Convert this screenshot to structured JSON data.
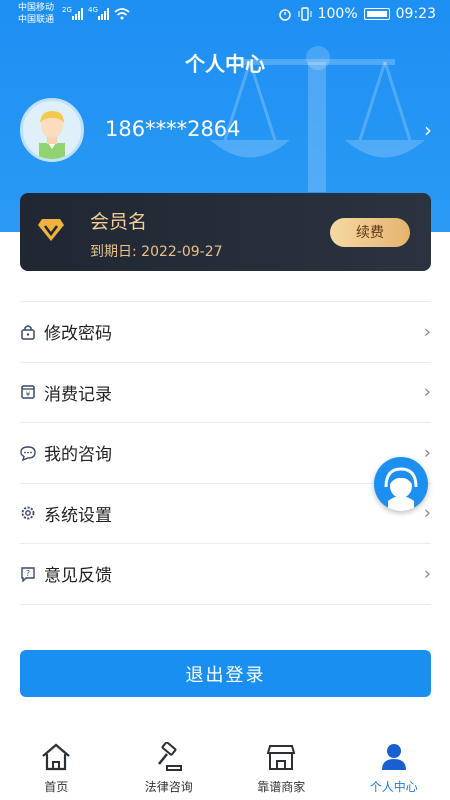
{
  "status_bar": {
    "carrier1": "中国移动",
    "carrier2": "中国联通",
    "net1": "2G",
    "net2": "4G",
    "battery": "100%",
    "time": "09:23"
  },
  "header": {
    "title": "个人中心"
  },
  "profile": {
    "phone": "186****2864"
  },
  "vip": {
    "name": "会员名",
    "expiry": "到期日: 2022-09-27",
    "renew_label": "续费"
  },
  "menu": [
    {
      "label": "修改密码",
      "icon": "lock-icon"
    },
    {
      "label": "消费记录",
      "icon": "receipt-icon"
    },
    {
      "label": "我的咨询",
      "icon": "chat-icon"
    },
    {
      "label": "系统设置",
      "icon": "gear-icon"
    },
    {
      "label": "意见反馈",
      "icon": "feedback-icon"
    }
  ],
  "logout_label": "退出登录",
  "tabs": [
    {
      "label": "首页",
      "icon": "home-icon"
    },
    {
      "label": "法律咨询",
      "icon": "gavel-icon"
    },
    {
      "label": "靠谱商家",
      "icon": "store-icon"
    },
    {
      "label": "个人中心",
      "icon": "user-icon",
      "active": true
    }
  ],
  "colors": {
    "primary": "#1a8ff2",
    "vip_gold": "#f4cf95",
    "card_dark": "#1f2733"
  }
}
